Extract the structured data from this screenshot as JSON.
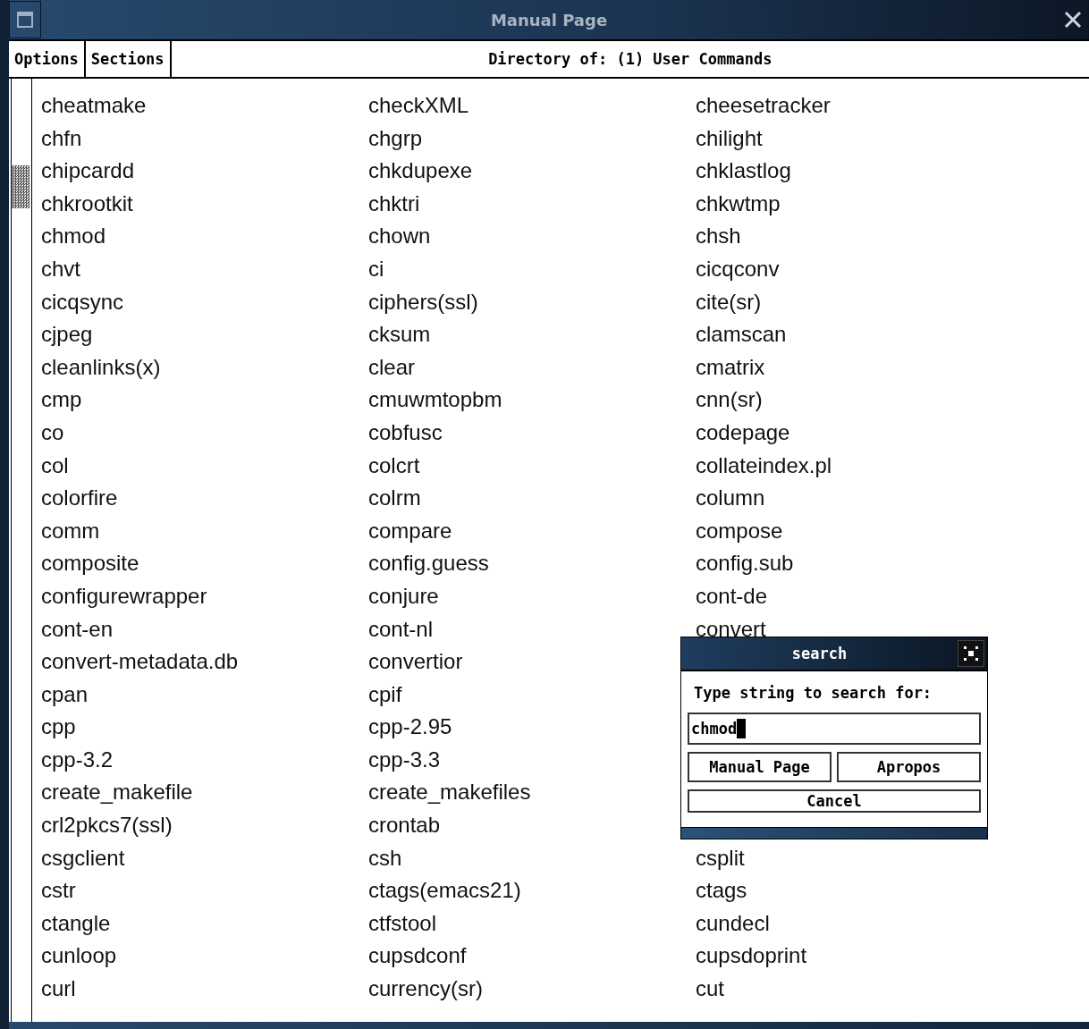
{
  "window": {
    "title": "Manual Page"
  },
  "menu": [
    {
      "label": "Options"
    },
    {
      "label": "Sections"
    }
  ],
  "heading": "Directory of: (1) User Commands",
  "rows": [
    [
      "cheatmake",
      "checkXML",
      "cheesetracker"
    ],
    [
      "chfn",
      "chgrp",
      "chilight"
    ],
    [
      "chipcardd",
      "chkdupexe",
      "chklastlog"
    ],
    [
      "chkrootkit",
      "chktri",
      "chkwtmp"
    ],
    [
      "chmod",
      "chown",
      "chsh"
    ],
    [
      "chvt",
      "ci",
      "cicqconv"
    ],
    [
      "cicqsync",
      "ciphers(ssl)",
      "cite(sr)"
    ],
    [
      "cjpeg",
      "cksum",
      "clamscan"
    ],
    [
      "cleanlinks(x)",
      "clear",
      "cmatrix"
    ],
    [
      "cmp",
      "cmuwmtopbm",
      "cnn(sr)"
    ],
    [
      "co",
      "cobfusc",
      "codepage"
    ],
    [
      "col",
      "colcrt",
      "collateindex.pl"
    ],
    [
      "colorfire",
      "colrm",
      "column"
    ],
    [
      "comm",
      "compare",
      "compose"
    ],
    [
      "composite",
      "config.guess",
      "config.sub"
    ],
    [
      "configurewrapper",
      "conjure",
      "cont-de"
    ],
    [
      "cont-en",
      "cont-nl",
      "convert"
    ],
    [
      "convert-metadata.db",
      "convertior"
    ],
    [
      "cpan",
      "cpif"
    ],
    [
      "cpp",
      "cpp-2.95"
    ],
    [
      "cpp-3.2",
      "cpp-3.3"
    ],
    [
      "create_makefile",
      "create_makefiles"
    ],
    [
      "crl2pkcs7(ssl)",
      "crontab"
    ],
    [
      "csgclient",
      "csh",
      "csplit"
    ],
    [
      "cstr",
      "ctags(emacs21)",
      "ctags"
    ],
    [
      "ctangle",
      "ctfstool",
      "cundecl"
    ],
    [
      "cunloop",
      "cupsdconf",
      "cupsdoprint"
    ],
    [
      "curl",
      "currency(sr)",
      "cut"
    ]
  ],
  "dialog": {
    "title": "search",
    "prompt": "Type string to search for:",
    "value": "chmod",
    "buttons": [
      "Manual Page",
      "Apropos"
    ],
    "cancel": "Cancel"
  }
}
